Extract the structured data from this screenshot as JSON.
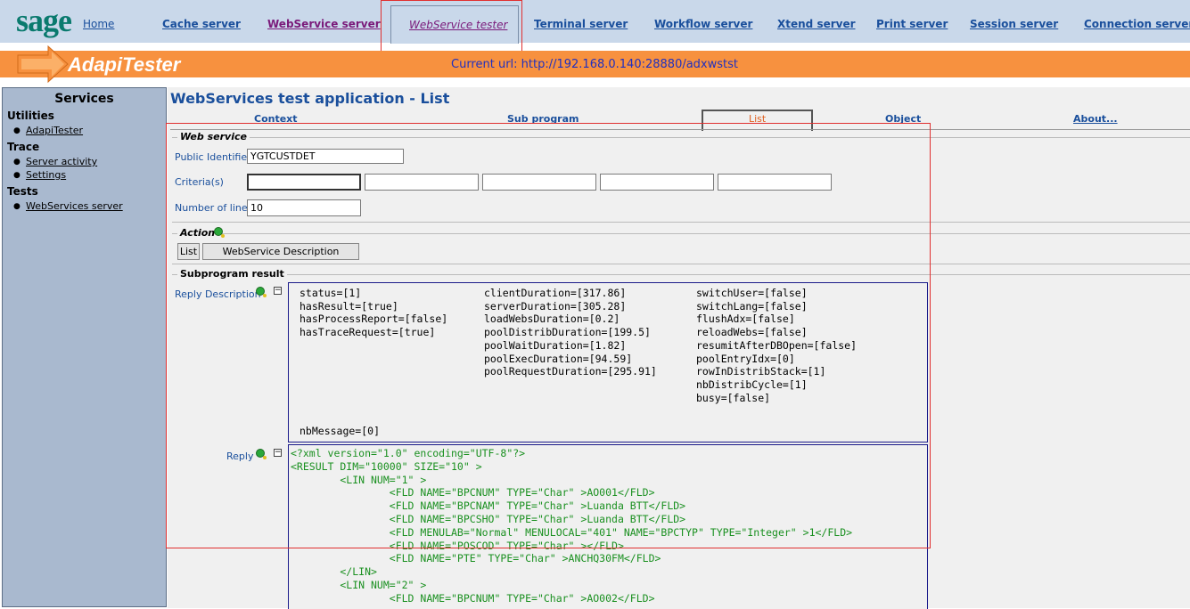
{
  "nav": {
    "logo": "sage",
    "home": "Home",
    "items": [
      "Cache server",
      "WebService server",
      "WebService tester",
      "Terminal server",
      "Workflow server",
      "Xtend server",
      "Print server",
      "Session server",
      "Connection server"
    ]
  },
  "banner": {
    "app_title": "AdapiTester",
    "current_url": "Current url: http://192.168.0.140:28880/adxwstst"
  },
  "sidebar": {
    "title": "Services",
    "sections": [
      {
        "heading": "Utilities",
        "links": [
          "AdapiTester"
        ]
      },
      {
        "heading": "Trace",
        "links": [
          "Server activity",
          "Settings"
        ]
      },
      {
        "heading": "Tests",
        "links": [
          "WebServices server"
        ]
      }
    ]
  },
  "page": {
    "title": "WebServices test application - List",
    "tabs": [
      "Context",
      "Sub program",
      "List",
      "Object",
      "About..."
    ]
  },
  "web_service": {
    "legend": "Web service",
    "public_identifier_label": "Public Identifier",
    "public_identifier_value": "YGTCUSTDET",
    "criteria_label": "Criteria(s)",
    "criteria_values": [
      "",
      "",
      "",
      "",
      ""
    ],
    "lines_label": "Number of lines",
    "lines_value": "10"
  },
  "action": {
    "legend": "Action",
    "list_button": "List",
    "description_button": "WebService Description"
  },
  "result": {
    "legend": "Subprogram result",
    "reply_description_label": "Reply Description",
    "reply_label": "Reply",
    "description_col1": "status=[1]\nhasResult=[true]\nhasProcessReport=[false]\nhasTraceRequest=[true]",
    "description_col2": "clientDuration=[317.86]\nserverDuration=[305.28]\nloadWebsDuration=[0.2]\npoolDistribDuration=[199.5]\npoolWaitDuration=[1.82]\npoolExecDuration=[94.59]\npoolRequestDuration=[295.91]",
    "description_col3": "switchUser=[false]\nswitchLang=[false]\nflushAdx=[false]\nreloadWebs=[false]\nresumitAfterDBOpen=[false]\npoolEntryIdx=[0]\nrowInDistribStack=[1]\nnbDistribCycle=[1]\nbusy=[false]",
    "nb_message": "nbMessage=[0]",
    "reply_xml": "<?xml version=\"1.0\" encoding=\"UTF-8\"?>\n<RESULT DIM=\"10000\" SIZE=\"10\" >\n        <LIN NUM=\"1\" >\n                <FLD NAME=\"BPCNUM\" TYPE=\"Char\" >AO001</FLD>\n                <FLD NAME=\"BPCNAM\" TYPE=\"Char\" >Luanda BTT</FLD>\n                <FLD NAME=\"BPCSHO\" TYPE=\"Char\" >Luanda BTT</FLD>\n                <FLD MENULAB=\"Normal\" MENULOCAL=\"401\" NAME=\"BPCTYP\" TYPE=\"Integer\" >1</FLD>\n                <FLD NAME=\"POSCOD\" TYPE=\"Char\" ></FLD>\n                <FLD NAME=\"PTE\" TYPE=\"Char\" >ANCHQ30FM</FLD>\n        </LIN>\n        <LIN NUM=\"2\" >\n                <FLD NAME=\"BPCNUM\" TYPE=\"Char\" >AO002</FLD>"
  }
}
